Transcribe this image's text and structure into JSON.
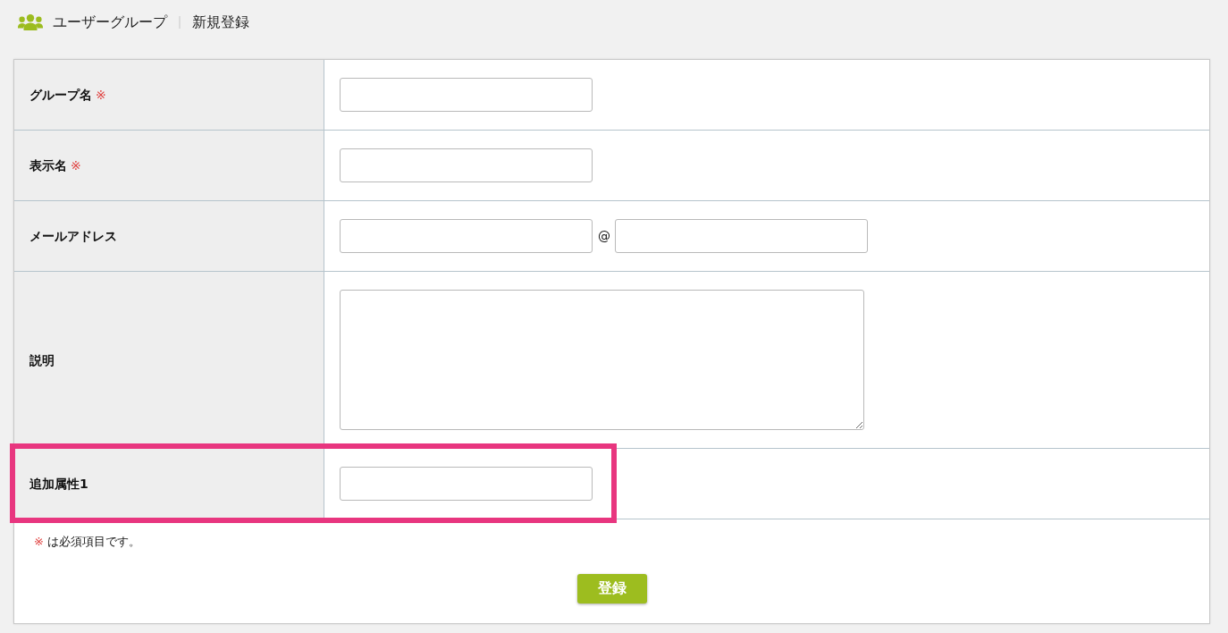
{
  "header": {
    "section": "ユーザーグループ",
    "page": "新規登録"
  },
  "rows": [
    {
      "label": "グループ名",
      "required_mark": "※",
      "kind": "text",
      "highlighted": false
    },
    {
      "label": "表示名",
      "required_mark": "※",
      "kind": "text",
      "highlighted": false
    },
    {
      "label": "メールアドレス",
      "kind": "email",
      "separator": "@",
      "highlighted": false
    },
    {
      "label": "説明",
      "kind": "textarea",
      "highlighted": false
    },
    {
      "label": "追加属性1",
      "kind": "text",
      "highlighted": true
    }
  ],
  "note": {
    "mark": "※",
    "text": "は必須項目です。"
  },
  "submit_button": "登録"
}
